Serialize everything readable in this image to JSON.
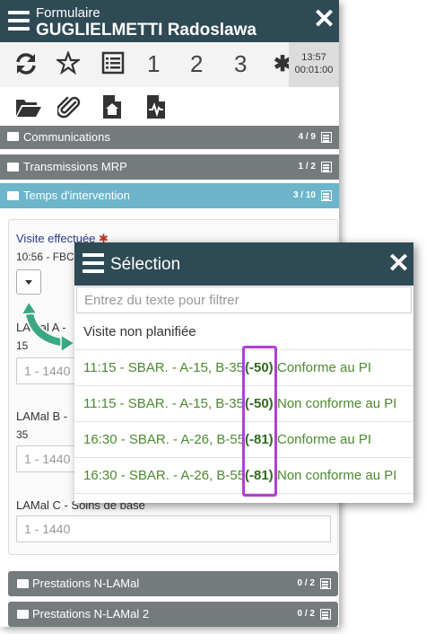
{
  "header": {
    "form_label": "Formulaire",
    "patient_name": "GUGLIELMETTI Radoslawa"
  },
  "toolbar": {
    "numbers": [
      "1",
      "2",
      "3"
    ],
    "time": "13:57",
    "duration": "00:01:00"
  },
  "sections": [
    {
      "label": "Communications",
      "count": "4 / 9"
    },
    {
      "label": "Transmissions MRP",
      "count": "1 / 2"
    },
    {
      "label": "Temps d'intervention",
      "count": "3 / 10"
    }
  ],
  "card": {
    "visit_label": "Visite effectuée",
    "visit_value": "10:56 - FBC",
    "lamal_a_label": "LAMal A -",
    "lamal_a_value": "15",
    "lamal_a_placeholder": "1 - 1440",
    "lamal_b_label": "LAMal B -",
    "lamal_b_value": "35",
    "lamal_b_placeholder": "1 - 1440",
    "lamal_c_label": "LAMal C - Soins de base",
    "lamal_c_placeholder": "1 - 1440"
  },
  "bottom_sections": [
    {
      "label": "Prestations N-LAMal",
      "count": "0 / 2"
    },
    {
      "label": "Prestations N-LAMal 2",
      "count": "0 / 2"
    }
  ],
  "popup": {
    "title": "Sélection",
    "filter_placeholder": "Entrez du texte pour filtrer",
    "first_option": "Visite non planifiée",
    "options": [
      {
        "time": "11:15 - SBAR. - A-15, B-35",
        "delta": "(-50)",
        "status": "Conforme au PI"
      },
      {
        "time": "11:15 - SBAR. - A-15, B-35",
        "delta": "(-50)",
        "status": "Non conforme au PI"
      },
      {
        "time": "16:30 - SBAR. - A-26, B-55",
        "delta": "(-81)",
        "status": "Conforme au PI"
      },
      {
        "time": "16:30 - SBAR. - A-26, B-55",
        "delta": "(-81)",
        "status": "Non conforme au PI"
      }
    ]
  },
  "colors": {
    "header": "#2e4a54",
    "active_section": "#6cb5cb",
    "section": "#757b7d",
    "option_text": "#4c8a2f",
    "highlight": "#b23fd2"
  }
}
